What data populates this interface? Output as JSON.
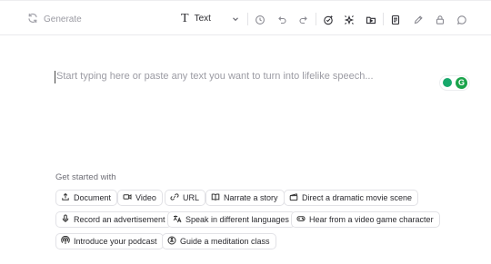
{
  "toolbar": {
    "generate_label": "Generate",
    "mode_label": "Text",
    "icons": [
      "history-icon",
      "undo-icon",
      "redo-icon",
      "magic-icon",
      "sparkle-frame-icon",
      "media-folder-icon",
      "document-icon",
      "pen-icon",
      "lock-icon",
      "comment-icon"
    ]
  },
  "editor": {
    "placeholder": "Start typing here or paste any text you want to turn into lifelike speech..."
  },
  "widget": {
    "badge_letter": "G"
  },
  "get_started": {
    "label": "Get started with",
    "chips": [
      {
        "label": "Document",
        "icon": "upload-icon"
      },
      {
        "label": "Video",
        "icon": "video-icon"
      },
      {
        "label": "URL",
        "icon": "link-icon"
      },
      {
        "label": "Narrate a story",
        "icon": "book-icon"
      },
      {
        "label": "Direct a dramatic movie scene",
        "icon": "clapperboard-icon"
      },
      {
        "label": "Record an advertisement",
        "icon": "microphone-icon"
      },
      {
        "label": "Speak in different languages",
        "icon": "translate-icon"
      },
      {
        "label": "Hear from a video game character",
        "icon": "gamepad-icon"
      },
      {
        "label": "Introduce your podcast",
        "icon": "podcast-icon"
      },
      {
        "label": "Guide a meditation class",
        "icon": "meditation-icon"
      }
    ]
  }
}
